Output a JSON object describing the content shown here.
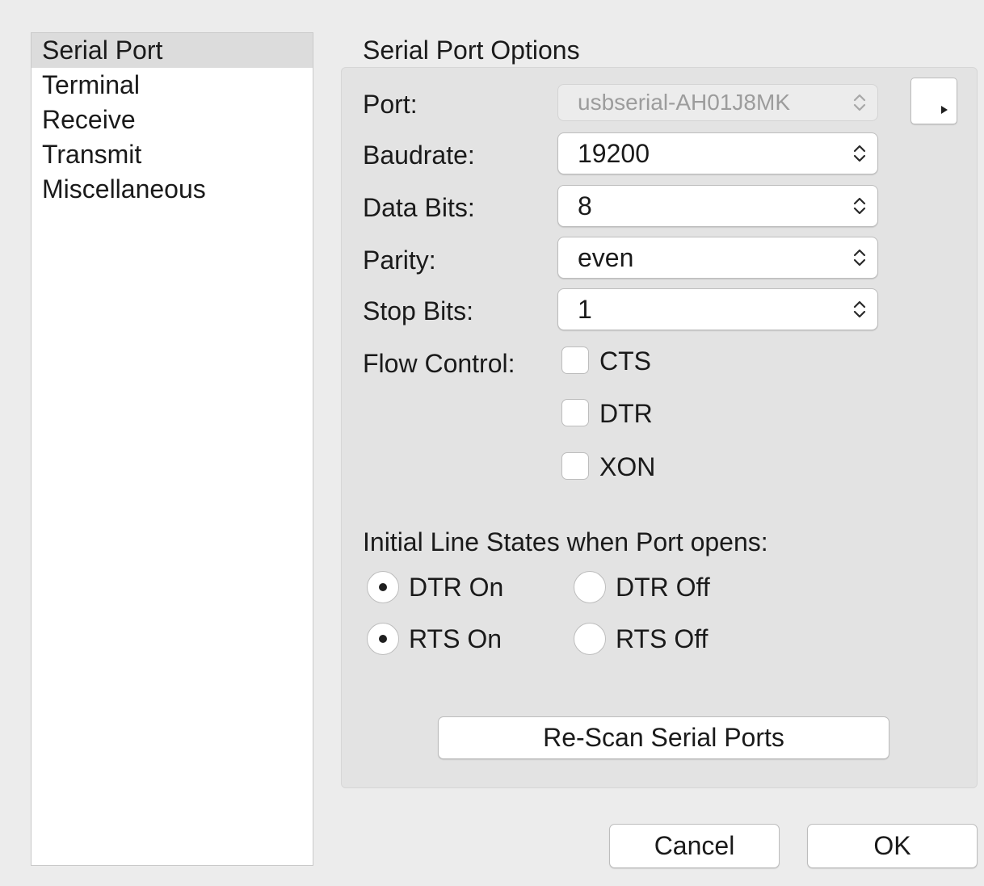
{
  "sidebar": {
    "items": [
      {
        "label": "Serial Port",
        "selected": true
      },
      {
        "label": "Terminal",
        "selected": false
      },
      {
        "label": "Receive",
        "selected": false
      },
      {
        "label": "Transmit",
        "selected": false
      },
      {
        "label": "Miscellaneous",
        "selected": false
      }
    ]
  },
  "options": {
    "title": "Serial Port Options",
    "port": {
      "label": "Port:",
      "value": "usbserial-AH01J8MK",
      "enabled": false
    },
    "baudrate": {
      "label": "Baudrate:",
      "value": "19200"
    },
    "data_bits": {
      "label": "Data Bits:",
      "value": "8"
    },
    "parity": {
      "label": "Parity:",
      "value": "even"
    },
    "stop_bits": {
      "label": "Stop Bits:",
      "value": "1"
    },
    "flow_control": {
      "label": "Flow Control:",
      "options": [
        {
          "label": "CTS",
          "checked": false
        },
        {
          "label": "DTR",
          "checked": false
        },
        {
          "label": "XON",
          "checked": false
        }
      ]
    },
    "side_button_icon": "triangle-right-icon"
  },
  "line_states": {
    "title": "Initial Line States when Port opens:",
    "dtr_on": {
      "label": "DTR On",
      "selected": true
    },
    "dtr_off": {
      "label": "DTR Off",
      "selected": false
    },
    "rts_on": {
      "label": "RTS On",
      "selected": true
    },
    "rts_off": {
      "label": "RTS Off",
      "selected": false
    }
  },
  "buttons": {
    "rescan": "Re-Scan Serial Ports",
    "cancel": "Cancel",
    "ok": "OK"
  }
}
